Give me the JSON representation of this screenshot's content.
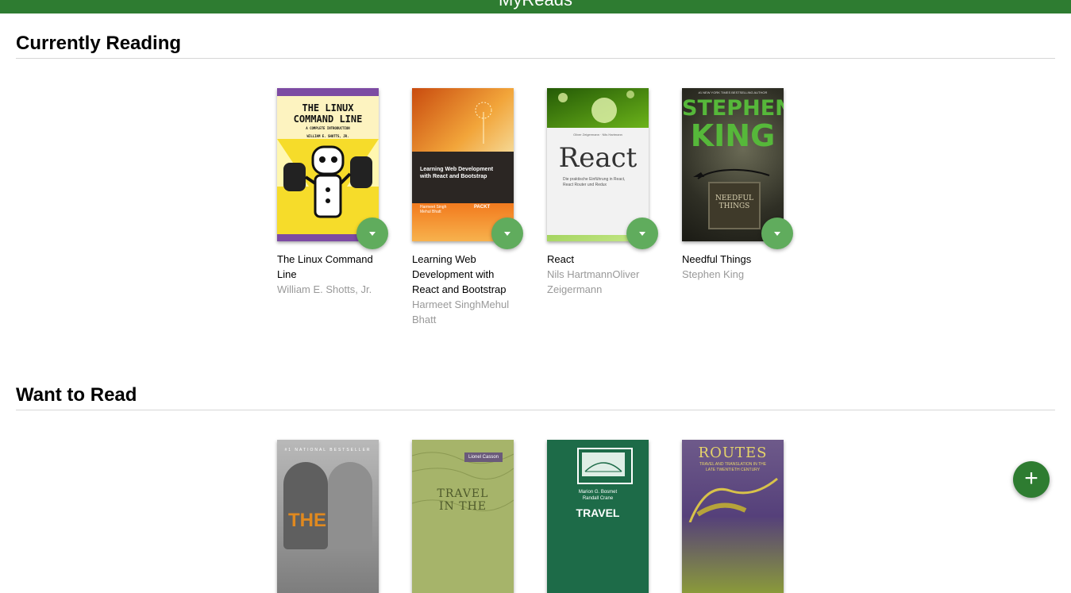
{
  "app": {
    "title": "MyReads"
  },
  "shelves": [
    {
      "title": "Currently Reading",
      "books": [
        {
          "title": "The Linux Command Line",
          "authors": "William E. Shotts, Jr.",
          "cover_text": [
            "THE LINUX",
            "COMMAND LINE",
            "A COMPLETE INTRODUCTION",
            "WILLIAM E. SHOTTS, JR."
          ]
        },
        {
          "title": "Learning Web Development with React and Bootstrap",
          "authors": "Harmeet SinghMehul Bhatt",
          "cover_text": [
            "Learning Web Development",
            "with React and Bootstrap",
            "Harmeet Singh",
            "Mehul Bhatt",
            "PACKT"
          ]
        },
        {
          "title": "React",
          "authors": "Nils HartmannOliver Zeigermann",
          "cover_text": [
            "React",
            "Oliver Zeigermann · Nils Hartmann",
            "Die praktische Einführung in React, React Router und Redux"
          ]
        },
        {
          "title": "Needful Things",
          "authors": "Stephen King",
          "cover_text": [
            "#1 NEW YORK TIMES BESTSELLING AUTHOR",
            "STEPHEN",
            "KING",
            "NEEDFUL THINGS"
          ]
        }
      ]
    },
    {
      "title": "Want to Read",
      "books": [
        {
          "title": "",
          "authors": "",
          "cover_text": [
            "#1 NATIONAL BESTSELLER",
            "THE"
          ]
        },
        {
          "title": "",
          "authors": "",
          "cover_text": [
            "Lionel Casson",
            "TRAVEL",
            "IN THE"
          ]
        },
        {
          "title": "",
          "authors": "",
          "cover_text": [
            "Marion G. Bosmet",
            "Randall Crane",
            "TRAVEL"
          ]
        },
        {
          "title": "",
          "authors": "",
          "cover_text": [
            "ROUTES",
            "TRAVEL AND TRANSLATION IN THE",
            "LATE TWENTIETH CENTURY"
          ]
        }
      ]
    }
  ],
  "add_button": {
    "label": "+"
  },
  "icons": {
    "shelf_changer": "caret-down-icon",
    "add": "plus-icon"
  },
  "colors": {
    "header": "#2e7c31",
    "shelf_changer": "#60ac5d",
    "add_button": "#2e7c31",
    "author_text": "#999999"
  }
}
